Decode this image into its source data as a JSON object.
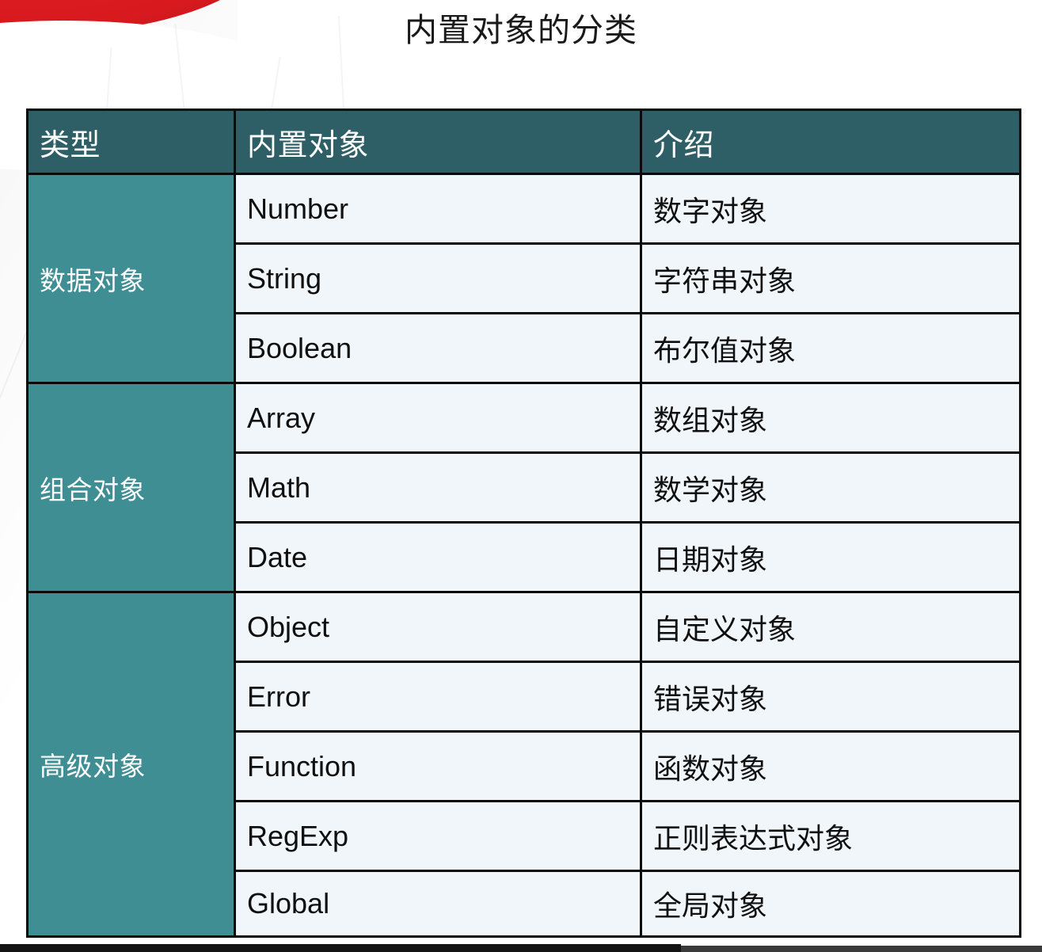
{
  "slide": {
    "title": "内置对象的分类",
    "accent_header_color": "#2F5F66",
    "accent_group_color": "#3E8E94",
    "cell_background_color": "#F1F6FA",
    "border_color": "#0A0A0A",
    "decoration": {
      "red_banner_color": "#D81A1F",
      "bottom_bar_color": "#3A3A3A"
    }
  },
  "table": {
    "headers": [
      "类型",
      "内置对象",
      "介绍"
    ],
    "groups": [
      {
        "type": "数据对象",
        "rows": [
          {
            "object": "Number",
            "desc": "数字对象"
          },
          {
            "object": "String",
            "desc": "字符串对象"
          },
          {
            "object": "Boolean",
            "desc": "布尔值对象"
          }
        ]
      },
      {
        "type": "组合对象",
        "rows": [
          {
            "object": "Array",
            "desc": "数组对象"
          },
          {
            "object": "Math",
            "desc": "数学对象"
          },
          {
            "object": "Date",
            "desc": "日期对象"
          }
        ]
      },
      {
        "type": "高级对象",
        "rows": [
          {
            "object": "Object",
            "desc": "自定义对象"
          },
          {
            "object": "Error",
            "desc": "错误对象"
          },
          {
            "object": "Function",
            "desc": "函数对象"
          },
          {
            "object": "RegExp",
            "desc": "正则表达式对象"
          },
          {
            "object": "Global",
            "desc": "全局对象"
          }
        ]
      }
    ]
  }
}
